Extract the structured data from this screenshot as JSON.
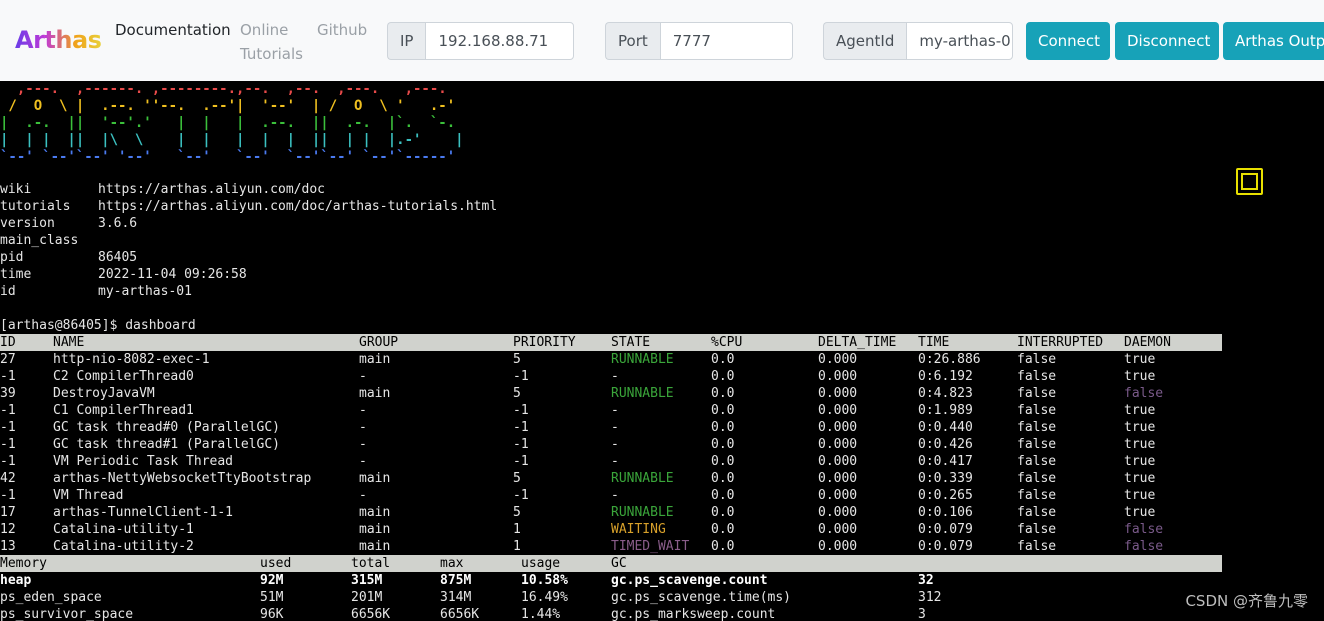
{
  "navbar": {
    "logo": "Arthas",
    "links": [
      "Documentation",
      "Online",
      "Tutorials",
      "Github"
    ],
    "ip_label": "IP",
    "ip_value": "192.168.88.71",
    "port_label": "Port",
    "port_value": "7777",
    "agent_label": "AgentId",
    "agent_value": "my-arthas-0",
    "connect": "Connect",
    "disconnect": "Disconnect",
    "output": "Arthas Output"
  },
  "terminal": {
    "banner": [
      "  ,---.  ,------. ,--------.,--.  ,--.  ,---.   ,---.  ",
      " /  O  \\ |  .--. ''--.  .--'|  '--'  | /  O  \\ '   .-' ",
      "|  .-.  ||  '--'.'   |  |   |  .--.  ||  .-.  |`.  `-. ",
      "|  | |  ||  |\\  \\    |  |   |  |  |  ||  | |  |.-'    |",
      "`--' `--'`--' '--'   `--'   `--'  `--'`--' `--'`-----' "
    ],
    "info": [
      {
        "k": "wiki",
        "v": "https://arthas.aliyun.com/doc"
      },
      {
        "k": "tutorials",
        "v": "https://arthas.aliyun.com/doc/arthas-tutorials.html"
      },
      {
        "k": "version",
        "v": "3.6.6"
      },
      {
        "k": "main_class",
        "v": ""
      },
      {
        "k": "pid",
        "v": "86405"
      },
      {
        "k": "time",
        "v": "2022-11-04 09:26:58"
      },
      {
        "k": "id",
        "v": "my-arthas-01"
      }
    ],
    "prompt": "[arthas@86405]$ dashboard",
    "thread_header": [
      "ID",
      "NAME",
      "GROUP",
      "PRIORITY",
      "STATE",
      "%CPU",
      "DELTA_TIME",
      "TIME",
      "INTERRUPTED",
      "DAEMON"
    ],
    "threads": [
      [
        "27",
        "http-nio-8082-exec-1",
        "main",
        "5",
        "RUNNABLE",
        "0.0",
        "0.000",
        "0:26.886",
        "false",
        "true"
      ],
      [
        "-1",
        "C2 CompilerThread0",
        "-",
        "-1",
        "-",
        "0.0",
        "0.000",
        "0:6.192",
        "false",
        "true"
      ],
      [
        "39",
        "DestroyJavaVM",
        "main",
        "5",
        "RUNNABLE",
        "0.0",
        "0.000",
        "0:4.823",
        "false",
        "false"
      ],
      [
        "-1",
        "C1 CompilerThread1",
        "-",
        "-1",
        "-",
        "0.0",
        "0.000",
        "0:1.989",
        "false",
        "true"
      ],
      [
        "-1",
        "GC task thread#0 (ParallelGC)",
        "-",
        "-1",
        "-",
        "0.0",
        "0.000",
        "0:0.440",
        "false",
        "true"
      ],
      [
        "-1",
        "GC task thread#1 (ParallelGC)",
        "-",
        "-1",
        "-",
        "0.0",
        "0.000",
        "0:0.426",
        "false",
        "true"
      ],
      [
        "-1",
        "VM Periodic Task Thread",
        "-",
        "-1",
        "-",
        "0.0",
        "0.000",
        "0:0.417",
        "false",
        "true"
      ],
      [
        "42",
        "arthas-NettyWebsocketTtyBootstrap",
        "main",
        "5",
        "RUNNABLE",
        "0.0",
        "0.000",
        "0:0.339",
        "false",
        "true"
      ],
      [
        "-1",
        "VM Thread",
        "-",
        "-1",
        "-",
        "0.0",
        "0.000",
        "0:0.265",
        "false",
        "true"
      ],
      [
        "17",
        "arthas-TunnelClient-1-1",
        "main",
        "5",
        "RUNNABLE",
        "0.0",
        "0.000",
        "0:0.106",
        "false",
        "true"
      ],
      [
        "12",
        "Catalina-utility-1",
        "main",
        "1",
        "WAITING",
        "0.0",
        "0.000",
        "0:0.079",
        "false",
        "false"
      ],
      [
        "13",
        "Catalina-utility-2",
        "main",
        "1",
        "TIMED_WAIT",
        "0.0",
        "0.000",
        "0:0.079",
        "false",
        "false"
      ]
    ],
    "memory_header": [
      "Memory",
      "used",
      "total",
      "max",
      "usage",
      "GC"
    ],
    "memory": [
      [
        "heap",
        "92M",
        "315M",
        "875M",
        "10.58%",
        "gc.ps_scavenge.count",
        "32"
      ],
      [
        "ps_eden_space",
        "51M",
        "201M",
        "314M",
        "16.49%",
        "gc.ps_scavenge.time(ms)",
        "312"
      ],
      [
        "ps_survivor_space",
        "96K",
        "6656K",
        "6656K",
        "1.44%",
        "gc.ps_marksweep.count",
        "3"
      ]
    ]
  },
  "colors": {
    "accent": "#17a2b8",
    "runnable": "#3aa53a",
    "waiting": "#d7a02a",
    "timed_wait": "#8a5d8a",
    "table_header_bg": "#d0d2cd"
  },
  "icons": [
    "fullscreen-icon"
  ],
  "watermark": "CSDN @齐鲁九零"
}
